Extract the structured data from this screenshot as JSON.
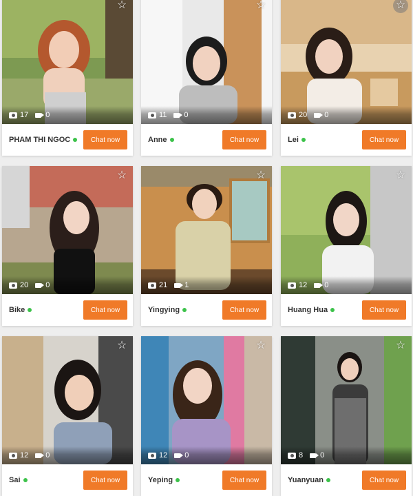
{
  "cards": [
    {
      "name": "PHAM THI NGOC",
      "photos": "17",
      "videos": "0",
      "online": true,
      "chat_label": "Chat now",
      "favorite_icon": "star-icon"
    },
    {
      "name": "Anne",
      "photos": "11",
      "videos": "0",
      "online": true,
      "chat_label": "Chat now",
      "favorite_icon": "star-icon"
    },
    {
      "name": "Lei",
      "photos": "20",
      "videos": "0",
      "online": true,
      "chat_label": "Chat now",
      "favorite_icon": "star-icon"
    },
    {
      "name": "Bike",
      "photos": "20",
      "videos": "0",
      "online": true,
      "chat_label": "Chat now",
      "favorite_icon": "star-icon"
    },
    {
      "name": "Yingying",
      "photos": "21",
      "videos": "1",
      "online": true,
      "chat_label": "Chat now",
      "favorite_icon": "star-icon"
    },
    {
      "name": "Huang Hua",
      "photos": "12",
      "videos": "0",
      "online": true,
      "chat_label": "Chat now",
      "favorite_icon": "star-icon"
    },
    {
      "name": "Sai",
      "photos": "12",
      "videos": "0",
      "online": true,
      "chat_label": "Chat now",
      "favorite_icon": "star-icon"
    },
    {
      "name": "Yeping",
      "photos": "12",
      "videos": "0",
      "online": true,
      "chat_label": "Chat now",
      "favorite_icon": "star-icon"
    },
    {
      "name": "Yuanyuan",
      "photos": "8",
      "videos": "0",
      "online": true,
      "chat_label": "Chat now",
      "favorite_icon": "star-icon"
    }
  ],
  "colors": {
    "accent": "#f07a28",
    "online": "#3cc24a",
    "card_bg": "#ffffff",
    "page_bg": "#eeeeee"
  }
}
